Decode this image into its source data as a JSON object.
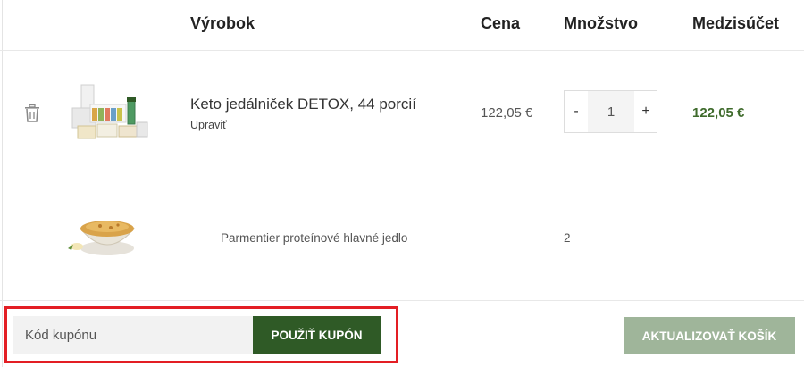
{
  "table": {
    "headers": {
      "product": "Výrobok",
      "price": "Cena",
      "quantity": "Množstvo",
      "subtotal": "Medzisúčet"
    }
  },
  "cart_item": {
    "name": "Keto jedálniček DETOX, 44 porcií",
    "edit_label": "Upraviť",
    "price": "122,05 €",
    "quantity": "1",
    "minus_label": "-",
    "plus_label": "+",
    "subtotal": "122,05 €"
  },
  "bundle_item": {
    "name": "Parmentier proteínové hlavné jedlo",
    "quantity": "2"
  },
  "coupon": {
    "placeholder": "Kód kupónu",
    "apply_label": "POUŽIŤ KUPÓN"
  },
  "actions": {
    "update_cart_label": "AKTUALIZOVAŤ KOŠÍK"
  },
  "colors": {
    "accent_green": "#2f5a26",
    "subtotal_green": "#3f6b2c",
    "disabled_green": "#9fb59a",
    "highlight_red": "#e31e24"
  },
  "icons": {
    "remove": "trash-icon"
  }
}
